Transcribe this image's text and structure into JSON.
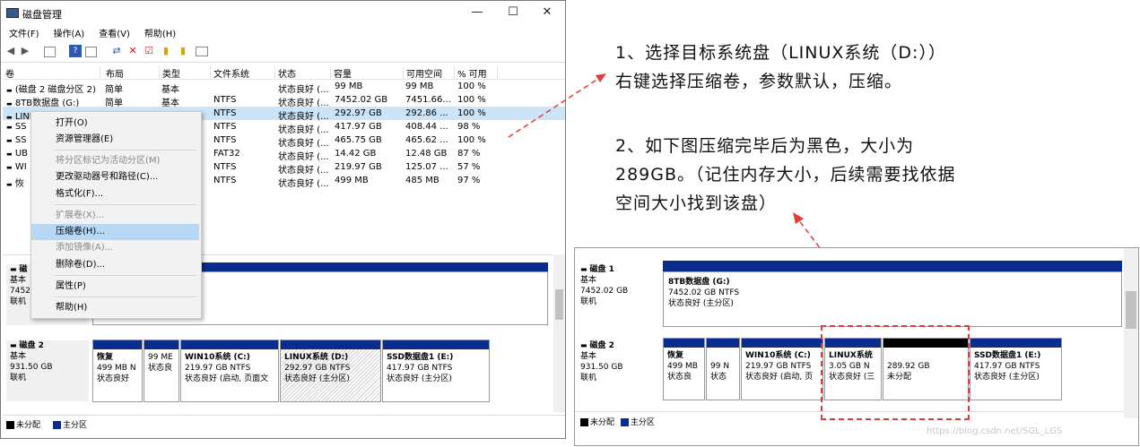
{
  "window": {
    "title": "磁盘管理",
    "controls": [
      "—",
      "☐",
      "✕"
    ]
  },
  "menu": [
    "文件(F)",
    "操作(A)",
    "查看(V)",
    "帮助(H)"
  ],
  "columns": [
    "卷",
    "布局",
    "类型",
    "文件系统",
    "状态",
    "容量",
    "可用空间",
    "% 可用"
  ],
  "volumes": [
    {
      "vol": "(磁盘 2 磁盘分区 2)",
      "layout": "简单",
      "type": "基本",
      "fs": "",
      "status": "状态良好 (...",
      "cap": "99 MB",
      "free": "99 MB",
      "pct": "100 %"
    },
    {
      "vol": "8TB数据盘 (G:)",
      "layout": "简单",
      "type": "基本",
      "fs": "NTFS",
      "status": "状态良好 (...",
      "cap": "7452.02 GB",
      "free": "7451.66...",
      "pct": "100 %"
    },
    {
      "vol": "LINUX系统 (D:)",
      "layout": "简单",
      "type": "基本",
      "fs": "NTFS",
      "status": "状态良好 (...",
      "cap": "292.97 GB",
      "free": "292.86 ...",
      "pct": "100 %"
    },
    {
      "vol": "SS",
      "layout": "",
      "type": "",
      "fs": "NTFS",
      "status": "状态良好 (...",
      "cap": "417.97 GB",
      "free": "408.44 ...",
      "pct": "98 %"
    },
    {
      "vol": "SS",
      "layout": "",
      "type": "",
      "fs": "NTFS",
      "status": "状态良好 (...",
      "cap": "465.75 GB",
      "free": "465.62 ...",
      "pct": "100 %"
    },
    {
      "vol": "UB",
      "layout": "",
      "type": "",
      "fs": "FAT32",
      "status": "状态良好 (...",
      "cap": "14.42 GB",
      "free": "12.48 GB",
      "pct": "87 %"
    },
    {
      "vol": "WI",
      "layout": "",
      "type": "",
      "fs": "NTFS",
      "status": "状态良好 (...",
      "cap": "219.97 GB",
      "free": "125.07 ...",
      "pct": "57 %"
    },
    {
      "vol": "恢",
      "layout": "",
      "type": "",
      "fs": "NTFS",
      "status": "状态良好 (...",
      "cap": "499 MB",
      "free": "485 MB",
      "pct": "97 %"
    }
  ],
  "context_menu": [
    {
      "label": "打开(O)",
      "disabled": false
    },
    {
      "label": "资源管理器(E)",
      "disabled": false
    },
    {
      "label": "将分区标记为活动分区(M)",
      "disabled": true
    },
    {
      "label": "更改驱动器号和路径(C)...",
      "disabled": false
    },
    {
      "label": "格式化(F)...",
      "disabled": false
    },
    {
      "label": "扩展卷(X)...",
      "disabled": true
    },
    {
      "label": "压缩卷(H)...",
      "disabled": false,
      "highlight": true
    },
    {
      "label": "添加镜像(A)...",
      "disabled": true
    },
    {
      "label": "删除卷(D)...",
      "disabled": false
    },
    {
      "label": "属性(P)",
      "disabled": false
    },
    {
      "label": "帮助(H)",
      "disabled": false
    }
  ],
  "disk1_left": {
    "name": "磁",
    "type": "基本",
    "size": "7452",
    "status": "联机"
  },
  "disk2_left": {
    "name": "磁盘 2",
    "type": "基本",
    "size": "931.50 GB",
    "status": "联机"
  },
  "disk2_parts": [
    {
      "name": "恢复",
      "size": "499 MB N",
      "status": "状态良好"
    },
    {
      "name": "",
      "size": "99 ME",
      "status": "状态良"
    },
    {
      "name": "WIN10系统 (C:)",
      "size": "219.97 GB NTFS",
      "status": "状态良好 (启动, 页面文"
    },
    {
      "name": "LINUX系统 (D:)",
      "size": "292.97 GB NTFS",
      "status": "状态良好 (主分区)"
    },
    {
      "name": "SSD数据盘1 (E:)",
      "size": "417.97 GB NTFS",
      "status": "状态良好 (主分区)"
    }
  ],
  "legend": {
    "unalloc": "未分配",
    "primary": "主分区"
  },
  "annotation1": {
    "line1": "1、选择目标系统盘（LINUX系统（D:））",
    "line2": "右键选择压缩卷，参数默认，压缩。"
  },
  "annotation2": {
    "line1": "2、如下图压缩完毕后为黑色，大小为",
    "line2": "289GB。（记住内存大小，后续需要找依据",
    "line3": "空间大小找到该盘）"
  },
  "w2_disk1": {
    "name": "磁盘 1",
    "type": "基本",
    "size": "7452.02 GB",
    "status": "联机"
  },
  "w2_disk1_part": {
    "name": "8TB数据盘 (G:)",
    "size": "7452.02 GB NTFS",
    "status": "状态良好 (主分区)"
  },
  "w2_disk2": {
    "name": "磁盘 2",
    "type": "基本",
    "size": "931.50 GB",
    "status": "联机"
  },
  "w2_disk2_parts": [
    {
      "name": "恢复",
      "size": "499 MB",
      "status": "状态良"
    },
    {
      "name": "",
      "size": "99 N",
      "status": "状态"
    },
    {
      "name": "WIN10系统 (C:)",
      "size": "219.97 GB NTFS",
      "status": "状态良好 (启动, 页"
    },
    {
      "name": "LINUX系统",
      "size": "3.05 GB N",
      "status": "状态良好 (三"
    },
    {
      "name": "",
      "size": "289.92 GB",
      "status": "未分配"
    },
    {
      "name": "SSD数据盘1 (E:)",
      "size": "417.97 GB NTFS",
      "status": "状态良好 (主分区)"
    }
  ],
  "watermark": "https://blog.csdn.net/SGL_LGS",
  "colors": {
    "primary": "#0a2c8c",
    "unalloc": "#000000",
    "red": "#e23b3b",
    "select": "#cce4f7"
  }
}
